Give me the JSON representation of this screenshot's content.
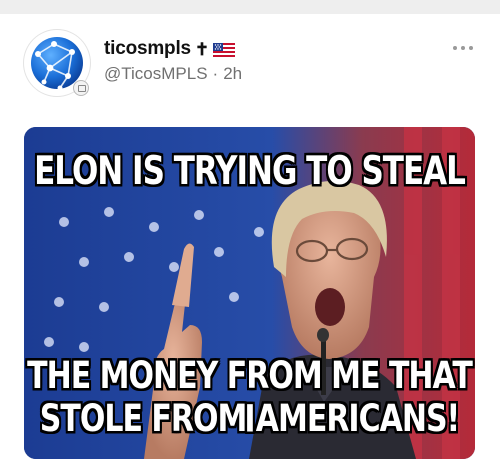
{
  "post": {
    "author": {
      "display_name": "ticosmpls",
      "cross_symbol": "✝",
      "handle": "@TicosMPLS",
      "separator": "·",
      "timestamp": "2h"
    },
    "more_icon": "more-horizontal-icon",
    "media": {
      "caption_top": "ELON IS TRYING TO STEAL",
      "caption_bottom_line1": "THE MONEY FROM ME THAT I",
      "caption_bottom_line2": "STOLE FROM AMERICANS!"
    }
  },
  "colors": {
    "name": "#111111",
    "meta": "#707070",
    "avatar_blue": "#1b6fd8",
    "flag_blue": "#1f3b8f",
    "flag_red": "#c8102e"
  }
}
